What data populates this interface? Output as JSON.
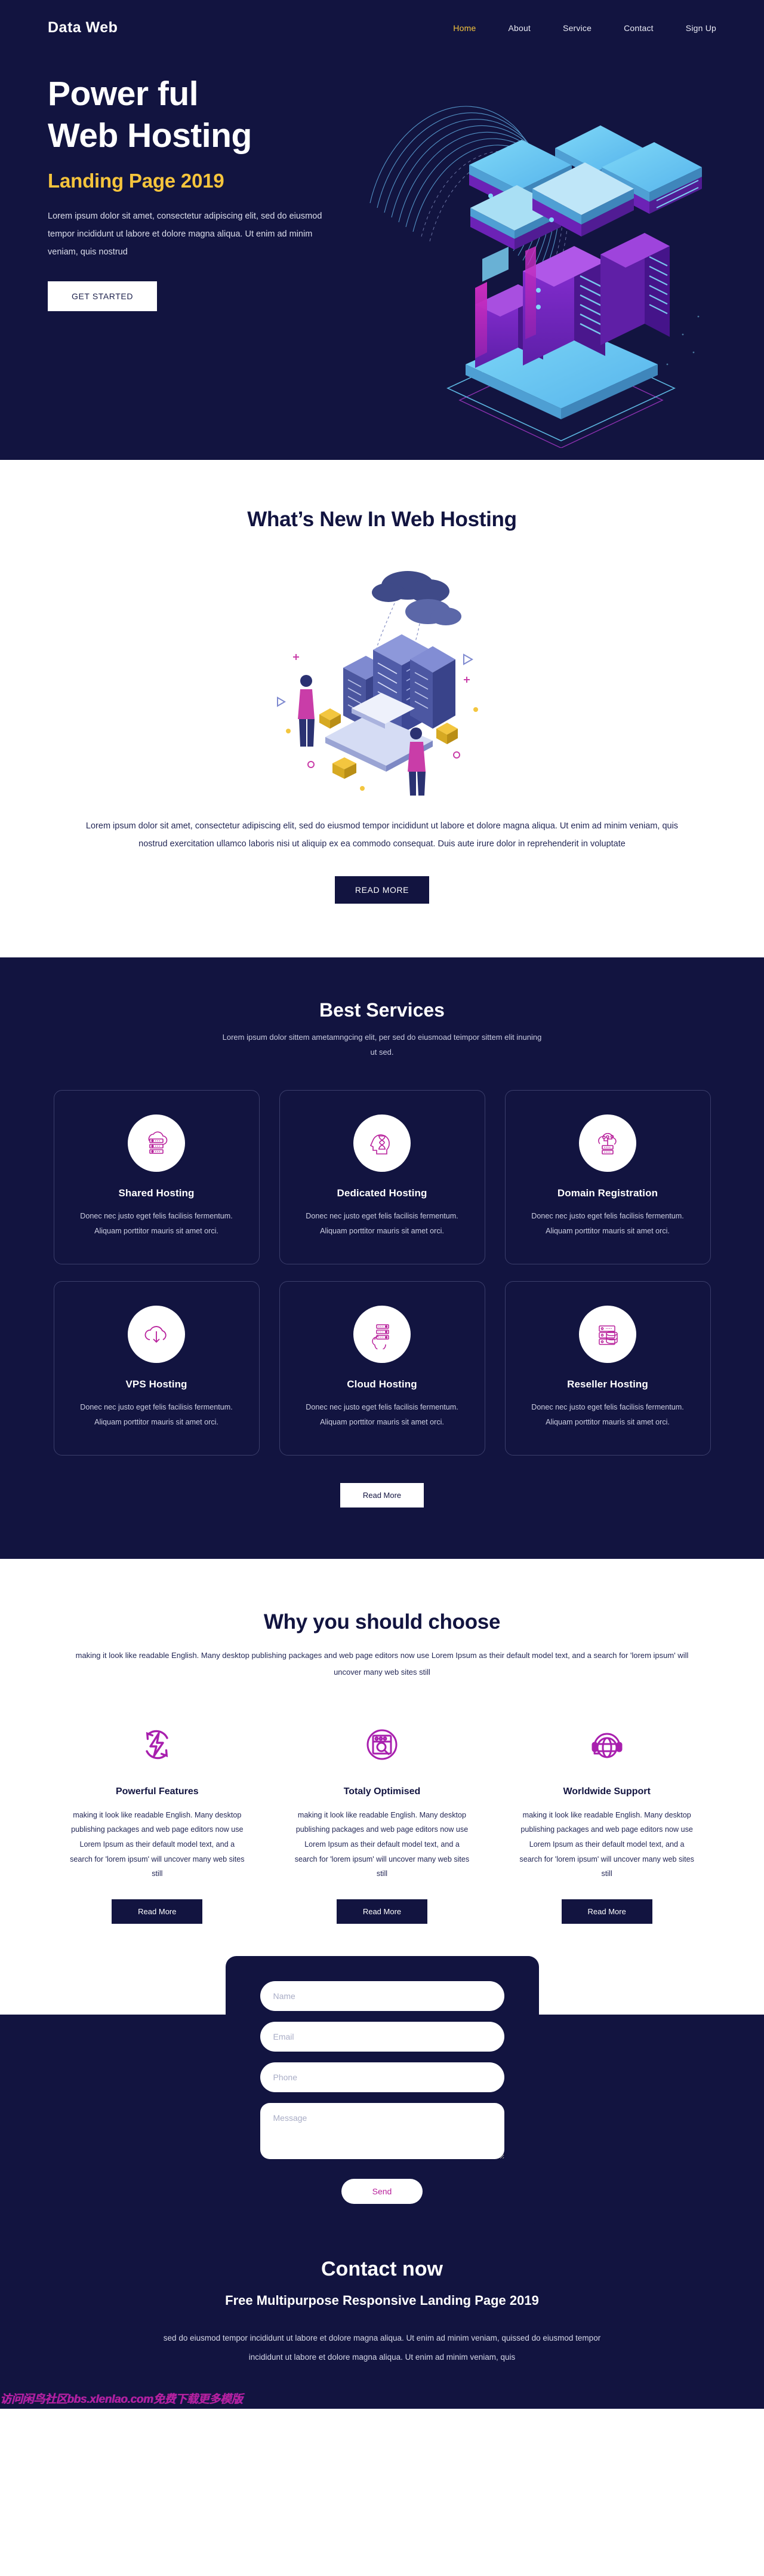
{
  "brand": "Data Web",
  "nav": {
    "items": [
      {
        "label": "Home",
        "active": true
      },
      {
        "label": "About",
        "active": false
      },
      {
        "label": "Service",
        "active": false
      },
      {
        "label": "Contact",
        "active": false
      },
      {
        "label": "Sign Up",
        "active": false
      }
    ]
  },
  "hero": {
    "title_line1": "Power ful",
    "title_line2": "Web Hosting",
    "subtitle": "Landing Page 2019",
    "paragraph": "Lorem ipsum dolor sit amet, consectetur adipiscing elit, sed do eiusmod tempor incididunt ut labore et dolore magna aliqua. Ut enim ad minim veniam, quis nostrud",
    "cta_label": "GET STARTED",
    "illustration": "isometric-server-stack"
  },
  "whats_new": {
    "title": "What’s New In Web Hosting",
    "illustration": "isometric-data-center-people",
    "paragraph": "Lorem ipsum dolor sit amet, consectetur adipiscing elit, sed do eiusmod tempor incididunt ut labore et dolore magna aliqua. Ut enim ad minim veniam, quis nostrud exercitation ullamco laboris nisi ut aliquip ex ea commodo consequat. Duis aute irure dolor in reprehenderit in voluptate",
    "cta_label": "READ MORE"
  },
  "services": {
    "title": "Best Services",
    "subtitle": "Lorem ipsum dolor sittem ametamngcing elit, per sed do eiusmoad teimpor sittem elit inuning ut sed.",
    "cards": [
      {
        "icon": "cloud-server-rack-icon",
        "title": "Shared Hosting",
        "text": "Donec nec justo eget felis facilisis fermentum. Aliquam porttitor mauris sit amet orci."
      },
      {
        "icon": "head-hourglass-icon",
        "title": "Dedicated Hosting",
        "text": "Donec nec justo eget felis facilisis fermentum. Aliquam porttitor mauris sit amet orci."
      },
      {
        "icon": "cloud-network-server-icon",
        "title": "Domain Registration",
        "text": "Donec nec justo eget felis facilisis fermentum. Aliquam porttitor mauris sit amet orci."
      },
      {
        "icon": "cloud-download-icon",
        "title": "VPS Hosting",
        "text": "Donec nec justo eget felis facilisis fermentum. Aliquam porttitor mauris sit amet orci."
      },
      {
        "icon": "server-cloud-stack-icon",
        "title": "Cloud Hosting",
        "text": "Donec nec justo eget felis facilisis fermentum. Aliquam porttitor mauris sit amet orci."
      },
      {
        "icon": "database-server-icon",
        "title": "Reseller Hosting",
        "text": "Donec nec justo eget felis facilisis fermentum. Aliquam porttitor mauris sit amet orci."
      }
    ],
    "cta_label": "Read More"
  },
  "why": {
    "title": "Why you should choose",
    "subtitle": "making it look like readable English. Many desktop publishing packages and web page editors now use Lorem Ipsum as their default model text, and a search for 'lorem ipsum' will uncover many web sites still",
    "features": [
      {
        "icon": "lightning-refresh-icon",
        "title": "Powerful Features",
        "text": "making it look like readable English. Many desktop publishing packages and web page editors now use Lorem Ipsum as their default model text, and a search for 'lorem ipsum' will uncover many web sites still",
        "cta_label": "Read More"
      },
      {
        "icon": "browser-search-icon",
        "title": "Totaly Optimised",
        "text": "making it look like readable English. Many desktop publishing packages and web page editors now use Lorem Ipsum as their default model text, and a search for 'lorem ipsum' will uncover many web sites still",
        "cta_label": "Read More"
      },
      {
        "icon": "globe-headset-icon",
        "title": "Worldwide Support",
        "text": "making it look like readable English. Many desktop publishing packages and web page editors now use Lorem Ipsum as their default model text, and a search for 'lorem ipsum' will uncover many web sites still",
        "cta_label": "Read More"
      }
    ]
  },
  "contact": {
    "form": {
      "name_placeholder": "Name",
      "email_placeholder": "Email",
      "phone_placeholder": "Phone",
      "message_placeholder": "Message",
      "name_value": "",
      "email_value": "",
      "phone_value": "",
      "message_value": "",
      "send_label": "Send"
    },
    "heading": "Contact now",
    "tagline": "Free Multipurpose Responsive Landing Page 2019",
    "paragraph": "sed do eiusmod tempor incididunt ut labore et dolore magna aliqua. Ut enim ad minim veniam, quissed do eiusmod tempor incididunt ut labore et dolore magna aliqua. Ut enim ad minim veniam, quis"
  },
  "watermark": "访问闲鸟社区bbs.xlenlao.com免费下载更多模版",
  "colors": {
    "navy": "#121440",
    "accent_yellow": "#f5c43c",
    "accent_magenta": "#b8219c",
    "white": "#ffffff"
  }
}
